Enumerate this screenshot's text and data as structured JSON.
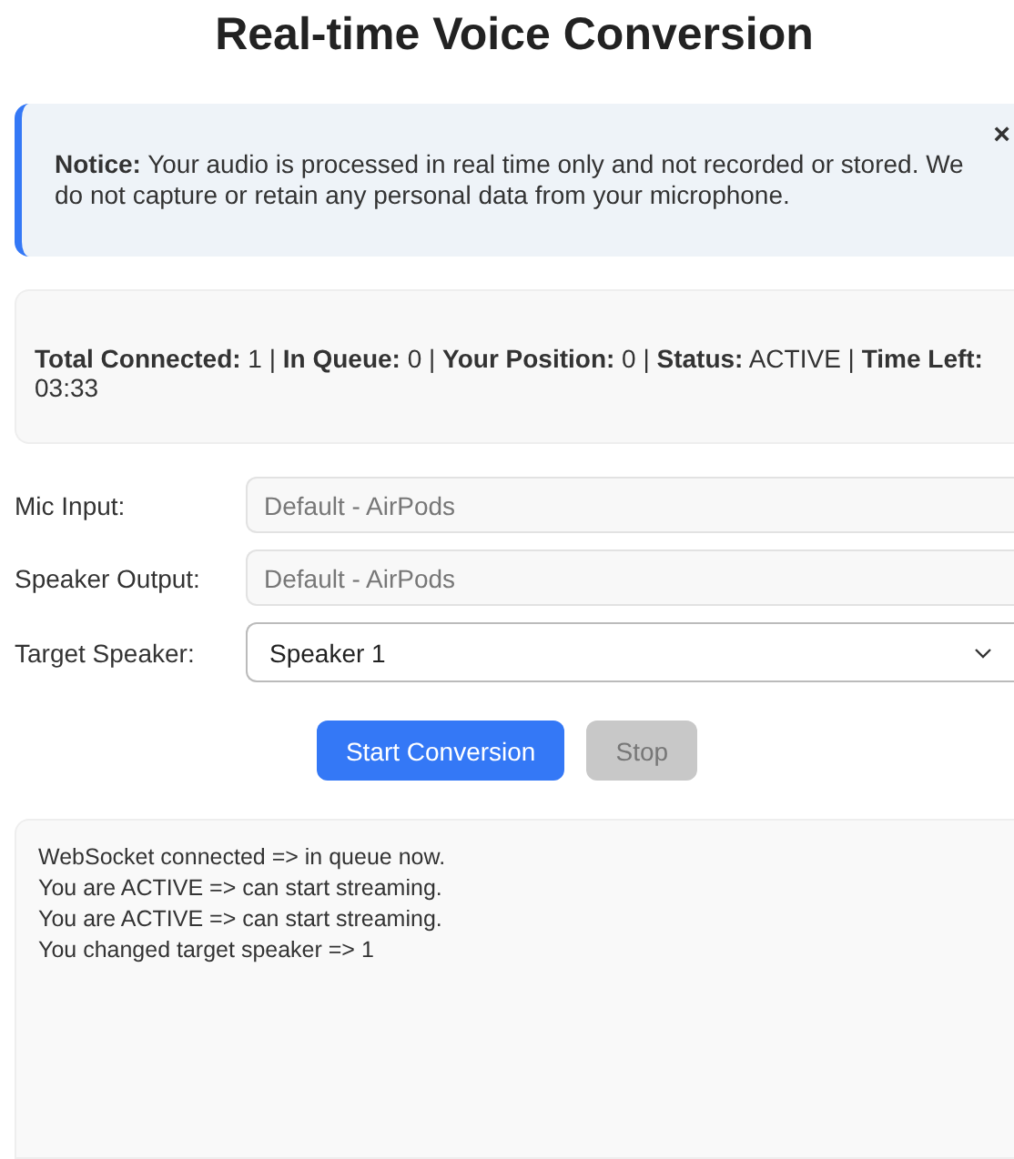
{
  "title": "Real-time Voice Conversion",
  "notice": {
    "text": "**Notice:** Your audio is processed in real time only and not recorded or stored. We do not capture or retain any personal data from your microphone.",
    "close": "×"
  },
  "status": "**Total Connected:** 1 | **In Queue:** 0 | **Your Position:** 0 | **Status:** ACTIVE | **Time Left:** 03:33",
  "fields": [
    {
      "label": "Mic Input:",
      "kind": "input",
      "value": "Default - AirPods",
      "disabled": true
    },
    {
      "label": "Speaker Output:",
      "kind": "input",
      "value": "Default - AirPods",
      "disabled": true
    },
    {
      "label": "Target Speaker:",
      "kind": "select",
      "value": "Speaker 1",
      "disabled": false
    }
  ],
  "buttons": [
    {
      "label": "Start Conversion",
      "disabled": false
    },
    {
      "label": "Stop",
      "disabled": true
    }
  ],
  "log": [
    "WebSocket connected => in queue now.",
    "You are ACTIVE => can start streaming.",
    "You are ACTIVE => can start streaming.",
    "You changed target speaker => 1"
  ]
}
